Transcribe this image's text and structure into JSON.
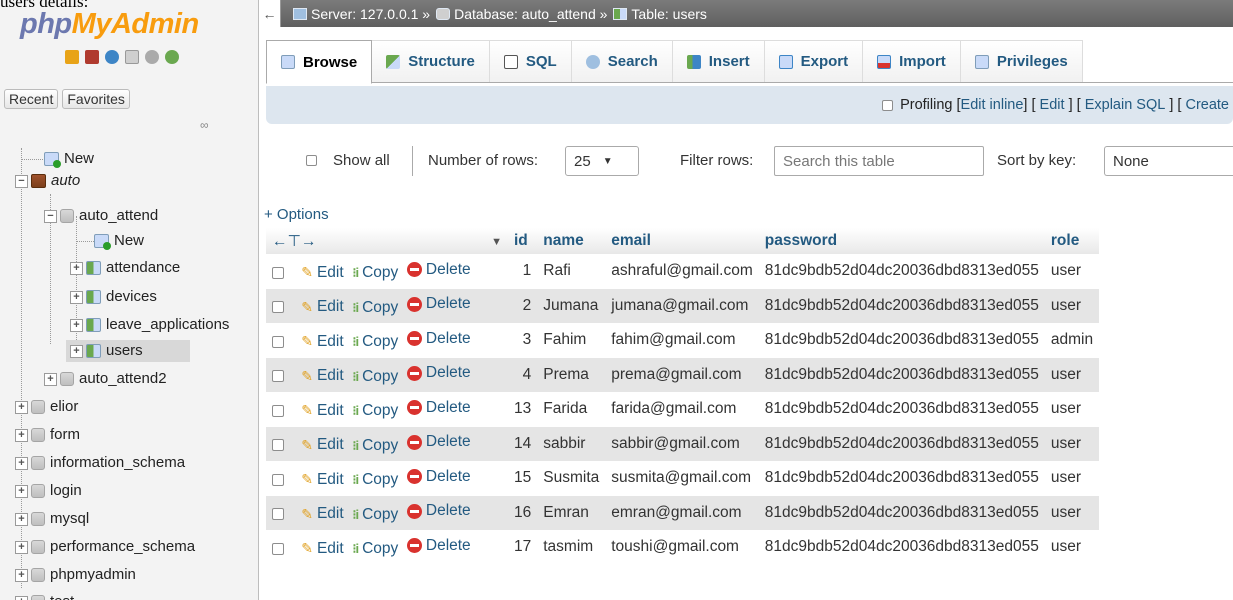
{
  "caption": "users details:",
  "logo": {
    "php": "php",
    "my": "My",
    "admin": "Admin"
  },
  "nav": {
    "recent": "Recent",
    "favorites": "Favorites",
    "tree": {
      "new": "New",
      "auto": "auto",
      "auto_attend": "auto_attend",
      "auto_attend_new": "New",
      "attendance": "attendance",
      "devices": "devices",
      "leave_applications": "leave_applications",
      "users": "users",
      "auto_attend2": "auto_attend2",
      "elior": "elior",
      "form": "form",
      "information_schema": "information_schema",
      "login": "login",
      "mysql": "mysql",
      "performance_schema": "performance_schema",
      "phpmyadmin": "phpmyadmin",
      "test": "test"
    }
  },
  "breadcrumb": {
    "server": "Server: 127.0.0.1 »",
    "database": "Database: auto_attend »",
    "table": "Table: users"
  },
  "tabs": [
    "Browse",
    "Structure",
    "SQL",
    "Search",
    "Insert",
    "Export",
    "Import",
    "Privileges"
  ],
  "profiling": {
    "label": "Profiling",
    "edit_inline": "Edit inline",
    "edit": "Edit",
    "explain": "Explain SQL",
    "create": "Create"
  },
  "navrow": {
    "show_all": "Show all",
    "rows_label": "Number of rows:",
    "rows_value": "25",
    "filter_label": "Filter rows:",
    "filter_placeholder": "Search this table",
    "sort_label": "Sort by key:",
    "sort_value": "None"
  },
  "options": "+ Options",
  "actions": {
    "edit": "Edit",
    "copy": "Copy",
    "delete": "Delete"
  },
  "table": {
    "columns": [
      "id",
      "name",
      "email",
      "password",
      "role"
    ],
    "rows": [
      [
        "1",
        "Rafi",
        "ashraful@gmail.com",
        "81dc9bdb52d04dc20036dbd8313ed055",
        "user"
      ],
      [
        "2",
        "Jumana",
        "jumana@gmail.com",
        "81dc9bdb52d04dc20036dbd8313ed055",
        "user"
      ],
      [
        "3",
        "Fahim",
        "fahim@gmail.com",
        "81dc9bdb52d04dc20036dbd8313ed055",
        "admin"
      ],
      [
        "4",
        "Prema",
        "prema@gmail.com",
        "81dc9bdb52d04dc20036dbd8313ed055",
        "user"
      ],
      [
        "13",
        "Farida",
        "farida@gmail.com",
        "81dc9bdb52d04dc20036dbd8313ed055",
        "user"
      ],
      [
        "14",
        "sabbir",
        "sabbir@gmail.com",
        "81dc9bdb52d04dc20036dbd8313ed055",
        "user"
      ],
      [
        "15",
        "Susmita",
        "susmita@gmail.com",
        "81dc9bdb52d04dc20036dbd8313ed055",
        "user"
      ],
      [
        "16",
        "Emran",
        "emran@gmail.com",
        "81dc9bdb52d04dc20036dbd8313ed055",
        "user"
      ],
      [
        "17",
        "tasmim",
        "toushi@gmail.com",
        "81dc9bdb52d04dc20036dbd8313ed055",
        "user"
      ]
    ]
  },
  "colors": {
    "link": "#235a81",
    "logo_blue": "#6c78af",
    "logo_orange": "#f89c0e",
    "crumb_bg": "#6d6d6d",
    "profiling_bg": "#dde6ef",
    "row_alt": "#e5e5e5"
  }
}
